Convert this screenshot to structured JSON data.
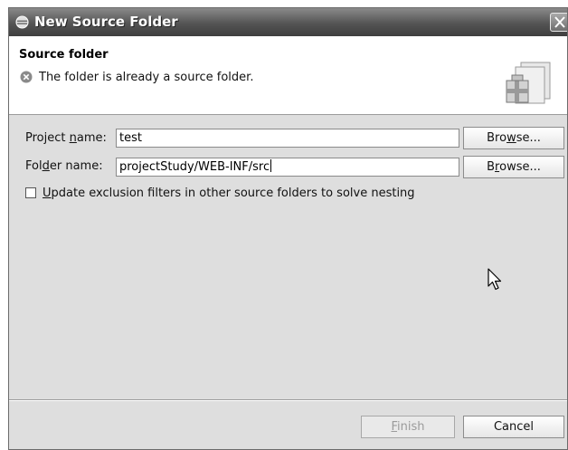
{
  "window": {
    "title": "New Source Folder",
    "close_label": "X"
  },
  "banner": {
    "title": "Source folder",
    "message": "The folder is already a source folder.",
    "message_icon": "error-icon"
  },
  "project": {
    "label_pre": "Project ",
    "label_mnemonic": "n",
    "label_post": "ame:",
    "value": "test",
    "browse_pre": "Bro",
    "browse_mnemonic": "w",
    "browse_post": "se..."
  },
  "folder": {
    "label_pre": "Fol",
    "label_mnemonic": "d",
    "label_post": "er name:",
    "value": "projectStudy/WEB-INF/src",
    "browse_pre": "B",
    "browse_mnemonic": "r",
    "browse_post": "owse..."
  },
  "option": {
    "label_mnemonic": "U",
    "label_rest": "pdate exclusion filters in other source folders to solve nesting",
    "checked": false
  },
  "buttons": {
    "finish_mnemonic": "F",
    "finish_rest": "inish",
    "finish_enabled": false,
    "cancel": "Cancel"
  },
  "colors": {
    "titlebar": "#545454",
    "dialog_bg": "#dedede",
    "banner_bg": "#ffffff",
    "disabled_text": "#9b9b9b"
  }
}
